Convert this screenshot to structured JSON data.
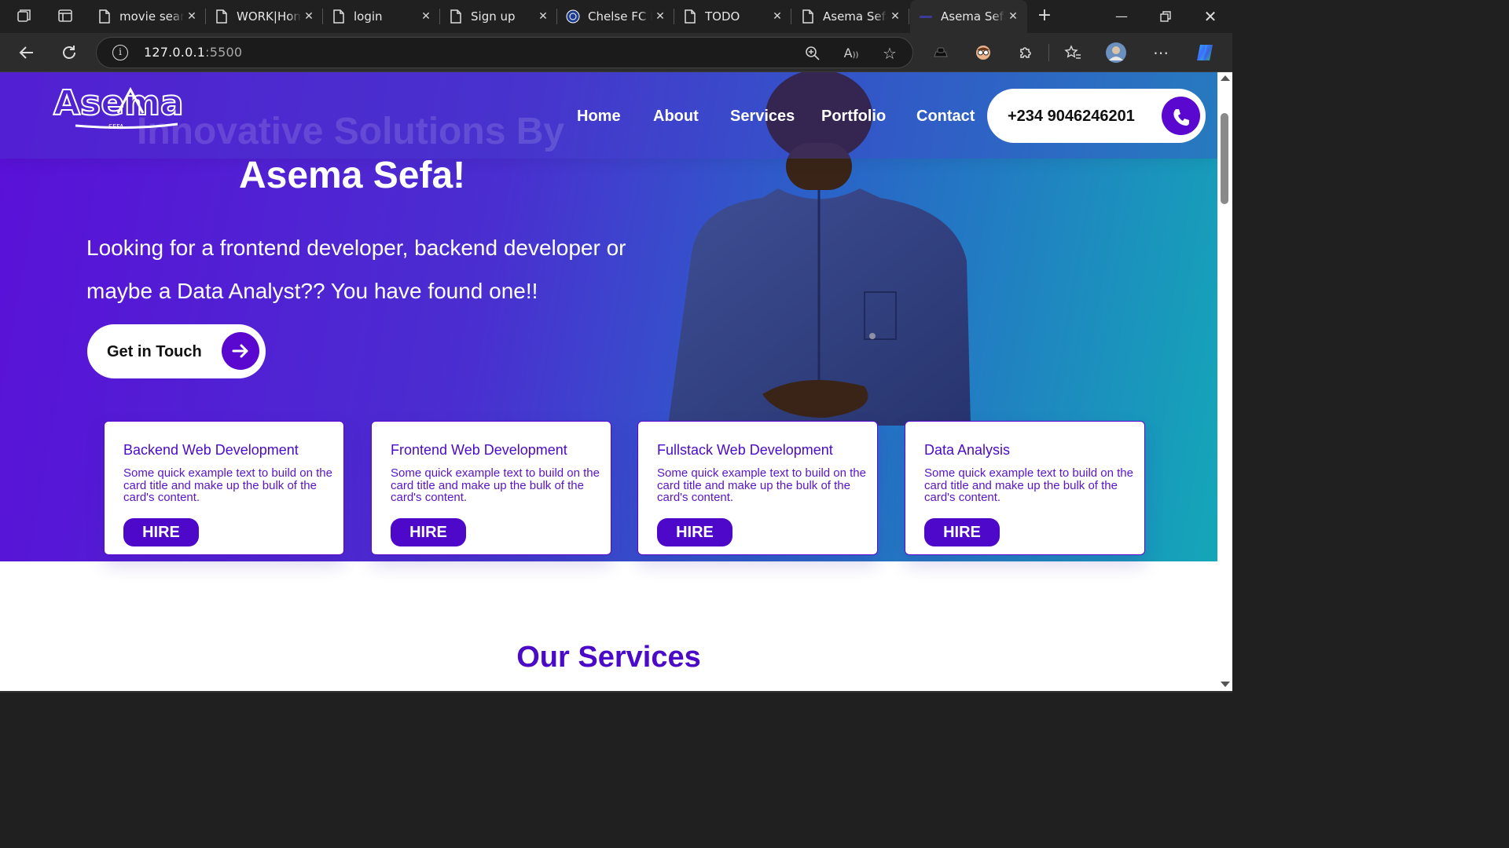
{
  "browser": {
    "tabs": [
      {
        "title": "movie search",
        "icon": "page-icon"
      },
      {
        "title": "WORK|Home",
        "icon": "page-icon"
      },
      {
        "title": "login",
        "icon": "page-icon"
      },
      {
        "title": "Sign up",
        "icon": "page-icon"
      },
      {
        "title": "Chelse FC Fans",
        "icon": "chelsea-crest-icon"
      },
      {
        "title": "TODO",
        "icon": "page-icon"
      },
      {
        "title": "Asema Sefa",
        "icon": "page-icon"
      },
      {
        "title": "Asema Sefa",
        "icon": "site-favicon",
        "active": true
      }
    ],
    "url_host": "127.0.0.1",
    "url_port": ":5500"
  },
  "site": {
    "logo_text": "Asema",
    "logo_sub": "SEFA",
    "nav": [
      "Home",
      "About",
      "Services",
      "Portfolio",
      "Contact"
    ],
    "phone": "+234 9046246201",
    "hero_ghost": "Innovative Solutions By",
    "hero_title": "Asema Sefa!",
    "hero_lead": "Looking for a frontend developer, backend developer or maybe a Data Analyst?? You have found one!!",
    "cta_label": "Get in Touch",
    "cards": [
      {
        "title": "Backend Web Development",
        "text": "Some quick example text to build on the card title and make up the bulk of the card's content.",
        "button": "HIRE"
      },
      {
        "title": "Frontend Web Development",
        "text": "Some quick example text to build on the card title and make up the bulk of the card's content.",
        "button": "HIRE"
      },
      {
        "title": "Fullstack Web Development",
        "text": "Some quick example text to build on the card title and make up the bulk of the card's content.",
        "button": "HIRE"
      },
      {
        "title": "Data Analysis",
        "text": "Some quick example text to build on the card title and make up the bulk of the card's content.",
        "button": "HIRE"
      }
    ],
    "services_title": "Our Services"
  },
  "colors": {
    "accent": "#5a08d0",
    "brand_text": "#4b0ac7",
    "gradient_start": "#5a10d8",
    "gradient_end": "#14a7b8"
  }
}
